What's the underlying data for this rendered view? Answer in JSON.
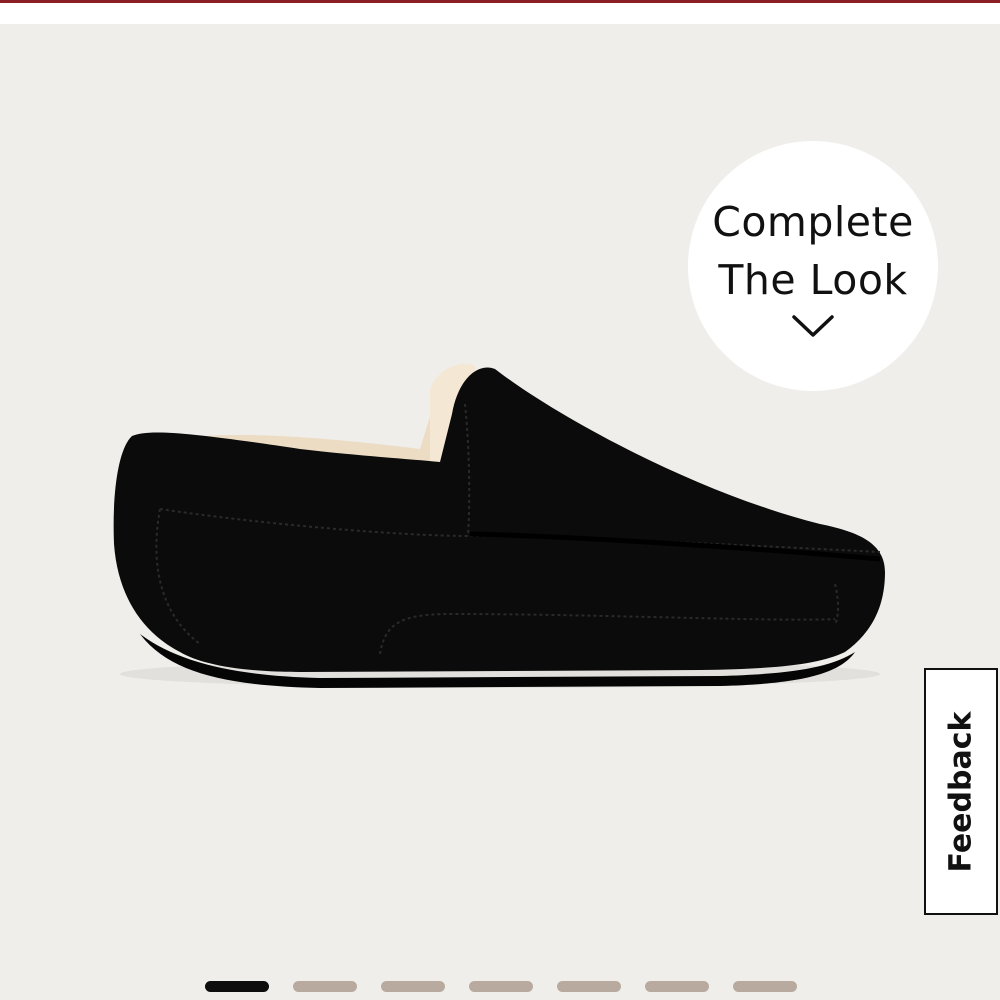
{
  "header": {
    "accent_color": "#8b1d24"
  },
  "product_image": {
    "alt": "Black suede slipper with sheepskin lining",
    "background_color": "#efeeeb"
  },
  "complete_the_look": {
    "line1": "Complete",
    "line2": "The Look",
    "icon": "chevron-down-icon"
  },
  "feedback": {
    "label": "Feedback"
  },
  "gallery_pager": {
    "total": 7,
    "active_index": 0,
    "active_color": "#0d0d0d",
    "inactive_color": "#b8aa9e"
  }
}
